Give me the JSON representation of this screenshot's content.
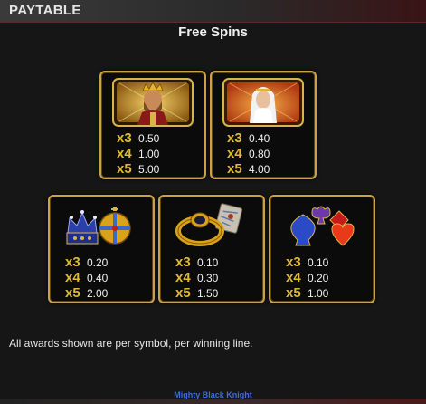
{
  "header": {
    "title": "PAYTABLE"
  },
  "section": {
    "title": "Free Spins"
  },
  "cards": [
    {
      "symbol": "king-icon",
      "pays": [
        {
          "mult": "x3",
          "amount": "0.50"
        },
        {
          "mult": "x4",
          "amount": "1.00"
        },
        {
          "mult": "x5",
          "amount": "5.00"
        }
      ]
    },
    {
      "symbol": "queen-icon",
      "pays": [
        {
          "mult": "x3",
          "amount": "0.40"
        },
        {
          "mult": "x4",
          "amount": "0.80"
        },
        {
          "mult": "x5",
          "amount": "4.00"
        }
      ]
    },
    {
      "symbol": "crown-orb-icon",
      "pays": [
        {
          "mult": "x3",
          "amount": "0.20"
        },
        {
          "mult": "x4",
          "amount": "0.40"
        },
        {
          "mult": "x5",
          "amount": "2.00"
        }
      ]
    },
    {
      "symbol": "ring-map-icon",
      "pays": [
        {
          "mult": "x3",
          "amount": "0.10"
        },
        {
          "mult": "x4",
          "amount": "0.30"
        },
        {
          "mult": "x5",
          "amount": "1.50"
        }
      ]
    },
    {
      "symbol": "card-suits-icon",
      "pays": [
        {
          "mult": "x3",
          "amount": "0.10"
        },
        {
          "mult": "x4",
          "amount": "0.20"
        },
        {
          "mult": "x5",
          "amount": "1.00"
        }
      ]
    }
  ],
  "note": "All awards shown are per symbol, per winning line.",
  "footer": {
    "game_name": "Mighty Black Knight"
  },
  "colors": {
    "gold": "#c9a24a",
    "multiplier": "#e1b932",
    "footer_text": "#3c6fd8"
  }
}
